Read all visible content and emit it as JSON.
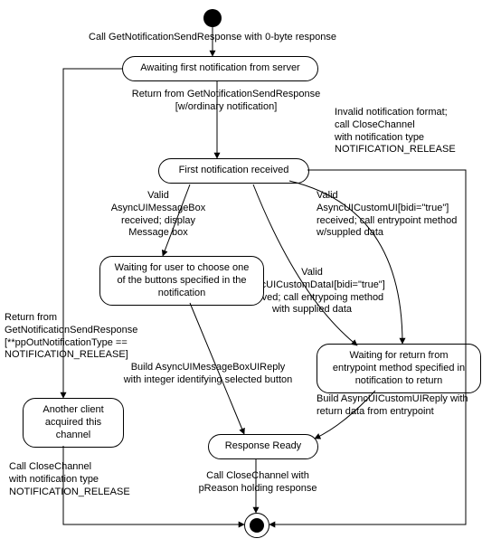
{
  "start_label": "Call GetNotificationSendResponse with 0-byte response",
  "state_await_first": "Awaiting first notification from server",
  "edge_return_ordinary": "Return from GetNotificationSendResponse\n[w/ordinary notification]",
  "edge_invalid_format": "Invalid notification format;\ncall CloseChannel\nwith notification type\nNOTIFICATION_RELEASE",
  "state_first_received": "First notification received",
  "edge_valid_msgbox": "Valid\nAsyncUIMessageBox\nreceived; display\nMessage box",
  "edge_valid_customui": "Valid\nAsyncUICustomUI[bidi=\"true\"]\nreceived; call entrypoint method\nw/suppled data",
  "edge_valid_customdata": "Valid\nAsyncUICustomDataI[bidi=\"true\"]\nreceived; call entrypoing method\nwith supplied data",
  "state_waiting_user": "Waiting for user to choose\none of the buttons specified\nin the notification",
  "edge_return_release": "Return from\nGetNotificationSendResponse\n[**ppOutNotificationType ==\nNOTIFICATION_RELEASE]",
  "state_waiting_entrypoint": "Waiting for return from\nentrypoint method specified\nin notification to return",
  "edge_build_msgbox_reply": "Build AsyncUIMessageBoxUIReply\nwith integer identifying selected button",
  "edge_build_customui_reply": "Build AsyncUICustomUIReply with\nreturn data from entrypoint",
  "state_another_client": "Another client\nacquired this\nchannel",
  "state_response_ready": "Response Ready",
  "edge_close_release": "Call CloseChannel\nwith notification type\nNOTIFICATION_RELEASE",
  "edge_close_preason": "Call CloseChannel with\npReason holding response"
}
